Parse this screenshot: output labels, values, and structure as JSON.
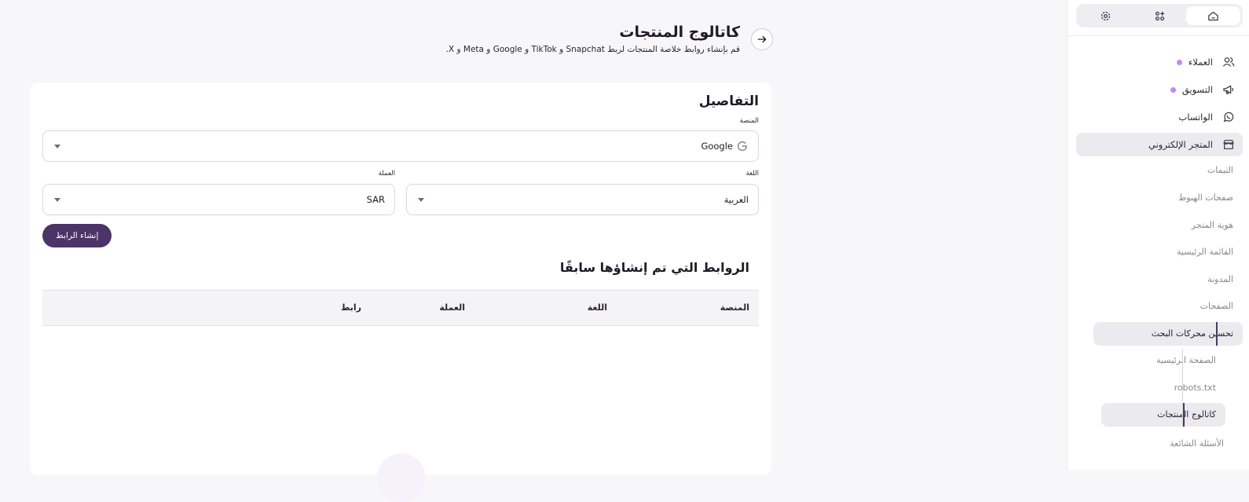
{
  "sidebar": {
    "top_tabs": [
      {
        "icon": "settings-icon"
      },
      {
        "icon": "apps-icon"
      },
      {
        "icon": "home-icon"
      }
    ],
    "items": [
      {
        "label": "العملاء",
        "icon": "users-icon"
      },
      {
        "label": "التسويق",
        "icon": "megaphone-icon"
      },
      {
        "label": "الواتساب",
        "icon": "whatsapp-icon"
      },
      {
        "label": "المتجر الإلكتروني",
        "icon": "store-icon"
      }
    ],
    "store_sub": [
      {
        "label": "الثيمات"
      },
      {
        "label": "صفحات الهبوط"
      },
      {
        "label": "هوية المتجر"
      },
      {
        "label": "القائمة الرئيسية"
      },
      {
        "label": "المدونة"
      },
      {
        "label": "الصفحات"
      },
      {
        "label": "تحسين محركات البحث"
      }
    ],
    "seo_sub": [
      {
        "label": "الصفحة الرئيسية"
      },
      {
        "label": "robots.txt"
      },
      {
        "label": "كاتالوج المنتجات"
      }
    ],
    "faq": {
      "label": "الأسئلة الشائعة"
    }
  },
  "header": {
    "title": "كاتالوج المنتجات",
    "subtitle": "قم بإنشاء روابط خلاصة المنتجات لربط Snapchat و TikTok و Google و Meta و X."
  },
  "details": {
    "title": "التفاصيل",
    "platform_label": "المنصة",
    "platform_value": "Google",
    "language_label": "اللغة",
    "language_value": "العربية",
    "currency_label": "العملة",
    "currency_value": "SAR",
    "create_button": "إنشاء الرابط"
  },
  "links": {
    "title": "الروابط التي تم إنشاؤها سابقًا",
    "columns": [
      "المنصة",
      "اللغة",
      "العملة",
      "رابط"
    ]
  },
  "colors": {
    "accent": "#4c3368",
    "dot": "#c08cf0",
    "background": "#f7f6f8"
  }
}
